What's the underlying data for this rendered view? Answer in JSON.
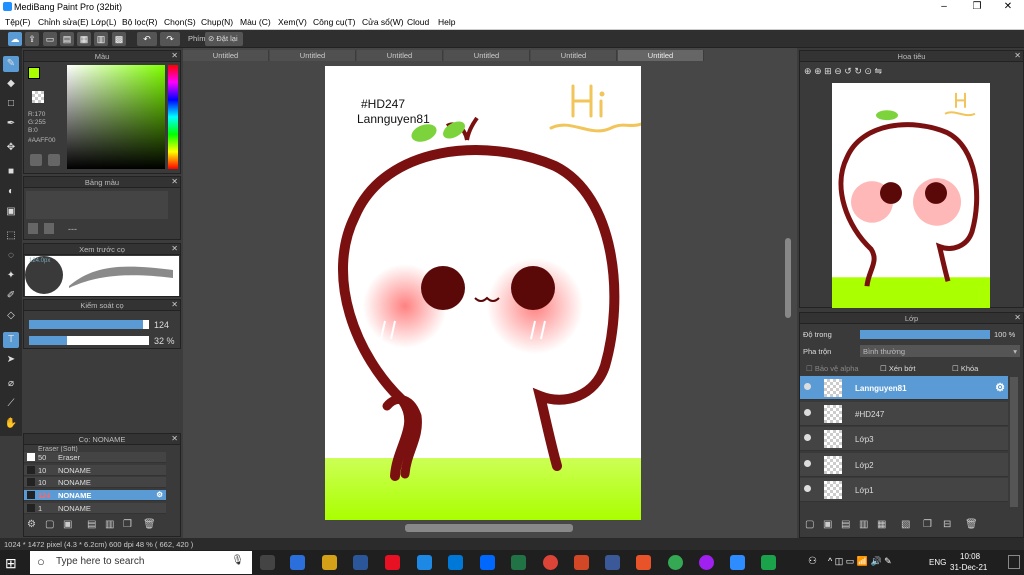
{
  "app": {
    "title": "MediBang Paint Pro (32bit)"
  },
  "menu": [
    "Tệp(F)",
    "Chỉnh sửa(E)",
    "Lớp(L)",
    "Bộ lọc(R)",
    "Chọn(S)",
    "Chụp(N)",
    "Màu (C)",
    "Xem(V)",
    "Công cụ(T)",
    "Cửa sổ(W)",
    "Cloud",
    "Help"
  ],
  "toolbar": {
    "phim_label": "Phím",
    "reset_label": "Đặt lại"
  },
  "color_panel": {
    "title": "Màu",
    "r": "R:170",
    "g": "G:255",
    "b": "B:0",
    "hex": "#AAFF00",
    "primary_color": "#AAFF00"
  },
  "palette_panel": {
    "title": "Bảng màu",
    "dash": "---"
  },
  "brush_preview": {
    "title": "Xem trước cọ",
    "size_label": "124.0px"
  },
  "brush_control": {
    "title": "Kiểm soát cọ",
    "size_value": "124",
    "opacity_value": "32 %",
    "size_fill": 0.95,
    "opacity_fill": 0.32
  },
  "brush_list": {
    "title": "Cọ: NONAME",
    "top_partial": "Eraser (Soft)",
    "items": [
      {
        "size": "50",
        "name": "Eraser"
      },
      {
        "size": "10",
        "name": "NONAME"
      },
      {
        "size": "10",
        "name": "NONAME"
      },
      {
        "size": "124",
        "name": "NONAME",
        "selected": true
      },
      {
        "size": "1",
        "name": "NONAME"
      }
    ]
  },
  "tabs": [
    "Untitled",
    "Untitled",
    "Untitled",
    "Untitled",
    "Untitled",
    "Untitled"
  ],
  "canvas": {
    "text1": "#HD247",
    "text2": "Lannguyen81",
    "hi": "Hi"
  },
  "navigator": {
    "title": "Hoa tiêu"
  },
  "layers_panel": {
    "title": "Lớp",
    "opacity_label": "Độ trong",
    "opacity_value": "100 %",
    "blend_label": "Pha trộn",
    "blend_value": "Bình thường",
    "alpha_label": "Bảo vệ alpha",
    "clip_label": "Xén bớt",
    "lock_label": "Khóa",
    "opacity_fill": 1.0
  },
  "layers": [
    {
      "name": "Lannguyen81",
      "selected": true
    },
    {
      "name": "#HD247",
      "selected": false
    },
    {
      "name": "Lớp3",
      "selected": false
    },
    {
      "name": "Lớp2",
      "selected": false
    },
    {
      "name": "Lớp1",
      "selected": false
    }
  ],
  "status": "1024 * 1472 pixel   (4.3 * 6.2cm)   600 dpi   48 %   ( 662, 420 )",
  "taskbar": {
    "search_placeholder": "Type here to search",
    "lang": "ENG",
    "time": "10:08",
    "date": "31-Dec-21"
  }
}
